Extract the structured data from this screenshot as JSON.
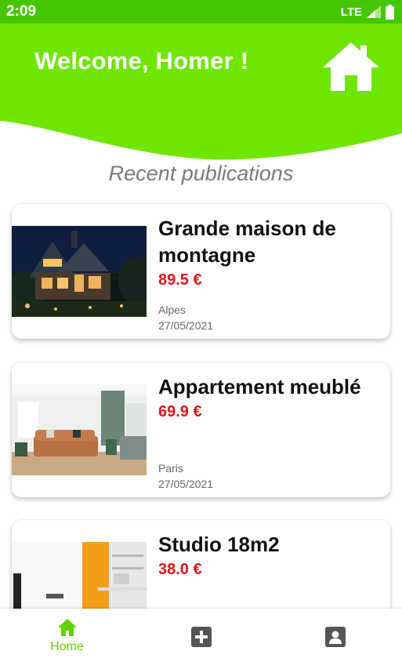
{
  "status_bar": {
    "time": "2:09",
    "network": "LTE"
  },
  "header": {
    "welcome": "Welcome, Homer !",
    "home_icon": "home-icon"
  },
  "section": {
    "title": "Recent publications"
  },
  "publications": [
    {
      "title": "Grande maison de montagne",
      "price": "89.5 €",
      "location": "Alpes",
      "date": "27/05/2021"
    },
    {
      "title": "Appartement meublé",
      "price": "69.9 €",
      "location": "Paris",
      "date": "27/05/2021"
    },
    {
      "title": "Studio 18m2",
      "price": "38.0 €",
      "location": "",
      "date": ""
    }
  ],
  "bottom_nav": [
    {
      "label": "Home",
      "icon": "home-icon",
      "active": true
    },
    {
      "label": "",
      "icon": "add-box-icon",
      "active": false
    },
    {
      "label": "",
      "icon": "account-box-icon",
      "active": false
    }
  ],
  "colors": {
    "accent": "#6fe600",
    "status_bar": "#46c600",
    "price": "#e5141b",
    "nav_active": "#5fd400",
    "nav_inactive": "#555555"
  }
}
